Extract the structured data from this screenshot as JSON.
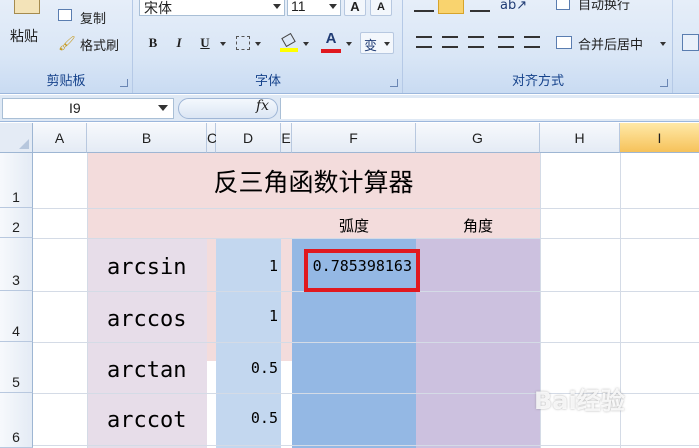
{
  "ribbon": {
    "clipboard": {
      "paste": "粘贴",
      "copy": "复制",
      "format_painter": "格式刷",
      "label": "剪贴板"
    },
    "font": {
      "family": "宋体",
      "size": "11",
      "grow": "A",
      "shrink": "A",
      "bold": "B",
      "italic": "I",
      "underline": "U",
      "font_color": "A",
      "phonetic": "变",
      "label": "字体"
    },
    "alignment": {
      "wrap_text": "自动换行",
      "merge_center": "合并后居中",
      "label": "对齐方式"
    }
  },
  "formula_bar": {
    "name_box": "I9",
    "fx": "fx",
    "value": ""
  },
  "sheet": {
    "columns": [
      "A",
      "B",
      "C",
      "D",
      "E",
      "F",
      "G",
      "H",
      "I"
    ],
    "selected_column": "I",
    "rows": [
      "1",
      "2",
      "3",
      "4",
      "5",
      "6"
    ],
    "title": "反三角函数计算器",
    "header_radian": "弧度",
    "header_degree": "角度",
    "functions": [
      {
        "name": "arcsin",
        "input": "1",
        "radian": "0.785398163"
      },
      {
        "name": "arccos",
        "input": "1",
        "radian": ""
      },
      {
        "name": "arctan",
        "input": "0.5",
        "radian": ""
      },
      {
        "name": "arccot",
        "input": "0.5",
        "radian": ""
      }
    ]
  },
  "colors": {
    "title_band": "#f3dcdc",
    "label_band": "#e7dde9",
    "input_band": "#c3d7ef",
    "radian_band": "#94b8e4",
    "degree_band": "#ccc1df",
    "highlight": "#e0191f"
  },
  "watermark": "Bai经验"
}
